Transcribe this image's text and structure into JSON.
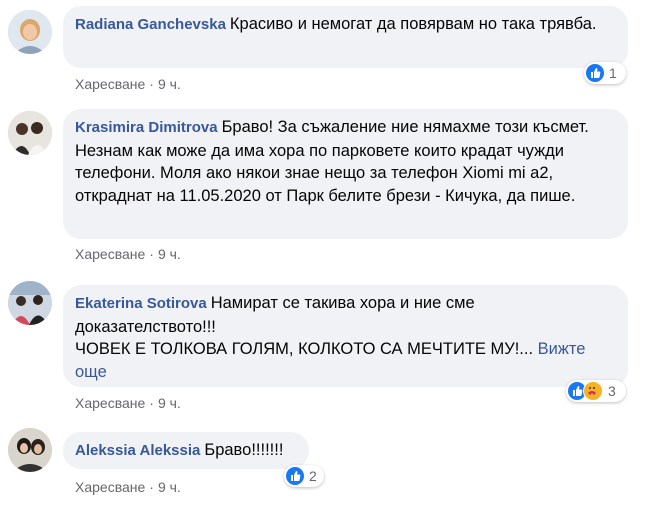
{
  "comments": [
    {
      "author": "Radiana Ganchevska",
      "text": "Красиво и немогат да повярвам но така трявба.",
      "like_label": "Харесване",
      "time": "9 ч.",
      "reaction_count": "1",
      "reactions": [
        "like-icon"
      ]
    },
    {
      "author": "Krasimira Dimitrova",
      "text": "Браво! За съжаление ние нямахме този късмет. Незнам как може да има хора по парковете които крадат чужди телефони. Моля ако някои знае нещо за телефон Xiomi mi a2, откраднат на 11.05.2020 от Парк белите брези - Кичука, да пише.",
      "like_label": "Харесване",
      "time": "9 ч."
    },
    {
      "author": "Ekaterina Sotirova",
      "text": "Намират се такива хора и ние сме доказателството!!!\nЧОВЕК Е ТОЛКОВА ГОЛЯМ, КОЛКОТО СА МЕЧТИТЕ МУ!...",
      "see_more": "Вижте още",
      "like_label": "Харесване",
      "time": "9 ч.",
      "reaction_count": "3",
      "reactions": [
        "like-icon",
        "care-icon"
      ]
    },
    {
      "author": "Alekssia Alekssia",
      "text": "Браво!!!!!!!",
      "like_label": "Харесване",
      "time": "9 ч.",
      "reaction_count": "2",
      "reactions": [
        "like-icon"
      ]
    }
  ],
  "colors": {
    "author": "#385898",
    "bubble": "#f0f2f5",
    "meta": "#65676b",
    "like_reaction": "#1877f2",
    "care_reaction": "#f7b125"
  },
  "separator": "·"
}
